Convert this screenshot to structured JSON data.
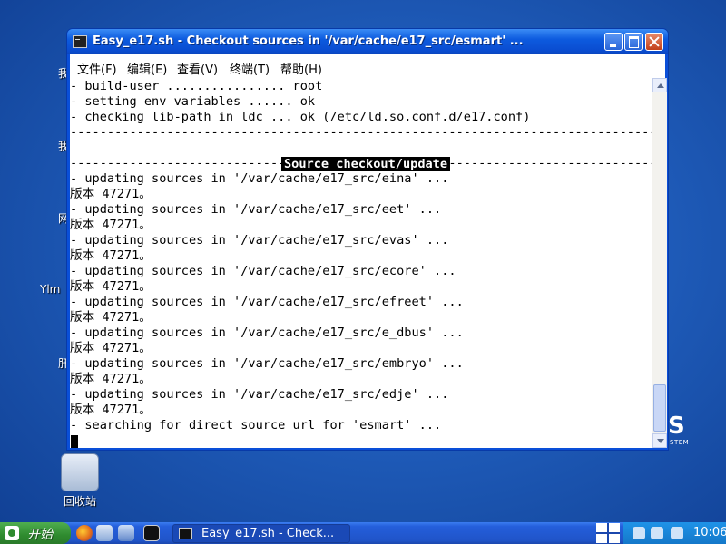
{
  "desktop": {
    "recycle_bin_label": "回收站",
    "partial_labels": [
      "我",
      "我",
      "网",
      "Ylm",
      "肝"
    ],
    "brand_letter": "S",
    "brand_sub": "STEM"
  },
  "window": {
    "title": "Easy_e17.sh - Checkout sources in '/var/cache/e17_src/esmart' ...",
    "menu": [
      "文件(F)",
      "编辑(E)",
      "查看(V)",
      "终端(T)",
      "帮助(H)"
    ],
    "terminal": {
      "lines": [
        "- build-user ................ root",
        "- setting env variables ...... ok",
        "- checking lib-path in ldc ... ok (/etc/ld.so.conf.d/e17.conf)",
        "--------------------------------------------------------------------------------",
        "",
        "--------------------------------------------------------------------------------",
        "- updating sources in '/var/cache/e17_src/eina' ...",
        "版本 47271。",
        "- updating sources in '/var/cache/e17_src/eet' ...",
        "版本 47271。",
        "- updating sources in '/var/cache/e17_src/evas' ...",
        "版本 47271。",
        "- updating sources in '/var/cache/e17_src/ecore' ...",
        "版本 47271。",
        "- updating sources in '/var/cache/e17_src/efreet' ...",
        "版本 47271。",
        "- updating sources in '/var/cache/e17_src/e_dbus' ...",
        "版本 47271。",
        "- updating sources in '/var/cache/e17_src/embryo' ...",
        "版本 47271。",
        "- updating sources in '/var/cache/e17_src/edje' ...",
        "版本 47271。",
        "- searching for direct source url for 'esmart' ..."
      ],
      "banner": "Source checkout/update"
    }
  },
  "taskbar": {
    "start_label": "开始",
    "task_label": "Easy_e17.sh - Check...",
    "clock": "10:06"
  }
}
